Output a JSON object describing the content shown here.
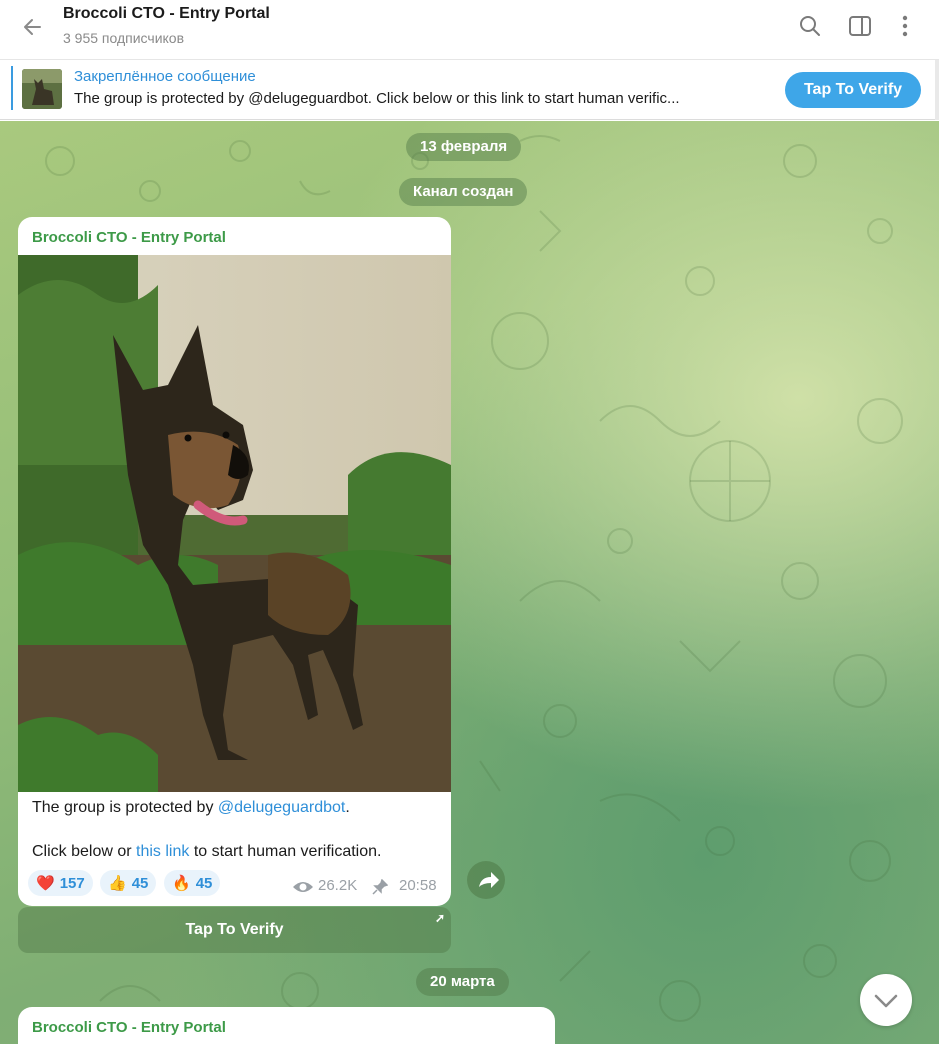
{
  "header": {
    "title": "Broccoli CTO - Entry Portal",
    "subscribers": "3 955 подписчиков",
    "icons": [
      "back-arrow-icon",
      "search-icon",
      "sidebar-toggle-icon",
      "more-vertical-icon"
    ]
  },
  "pinned": {
    "title": "Закреплённое сообщение",
    "text": "The group is protected by @delugeguardbot.  Click below or this link to start human verific...",
    "button": "Tap To Verify"
  },
  "chat": {
    "date1": "13 февраля",
    "service": "Канал создан",
    "message": {
      "sender": "Broccoli CTO - Entry Portal",
      "text_prefix": "The group is protected by ",
      "mention": "@delugeguardbot",
      "text_suffix": ".",
      "line2_prefix": "Click below or ",
      "line2_link": "this link",
      "line2_suffix": " to start human verification.",
      "reactions": [
        {
          "emoji": "❤️",
          "count": "157"
        },
        {
          "emoji": "👍",
          "count": "45"
        },
        {
          "emoji": "🔥",
          "count": "45"
        }
      ],
      "views": "26.2K",
      "time": "20:58",
      "button": "Tap To Verify"
    },
    "date2": "20 марта",
    "message2": {
      "sender": "Broccoli CTO - Entry Portal"
    }
  },
  "colors": {
    "accent": "#3ea6e8",
    "link": "#2f8fd8",
    "sender": "#3d9a48"
  }
}
